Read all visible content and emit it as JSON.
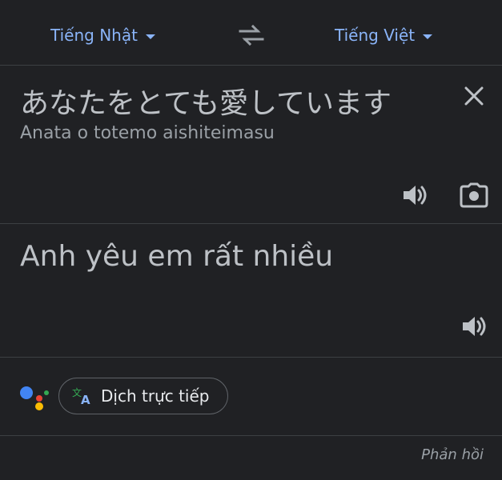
{
  "languages": {
    "source": "Tiếng Nhật",
    "target": "Tiếng Việt"
  },
  "input": {
    "text": "あなたをとても愛しています",
    "romanization": "Anata o totemo aishiteimasu"
  },
  "output": {
    "text": "Anh yêu em rất nhiều"
  },
  "assistant": {
    "chip_label": "Dịch trực tiếp"
  },
  "footer": {
    "feedback": "Phản hồi"
  },
  "colors": {
    "background": "#202124",
    "accent": "#8ab4f8",
    "text": "#bdc1c6",
    "divider": "#3c4043"
  },
  "icons": {
    "swap": "swap-arrows-icon",
    "clear": "close-icon",
    "speaker": "speaker-icon",
    "camera": "camera-icon",
    "assistant": "google-assistant-icon",
    "translate": "translate-icon"
  }
}
